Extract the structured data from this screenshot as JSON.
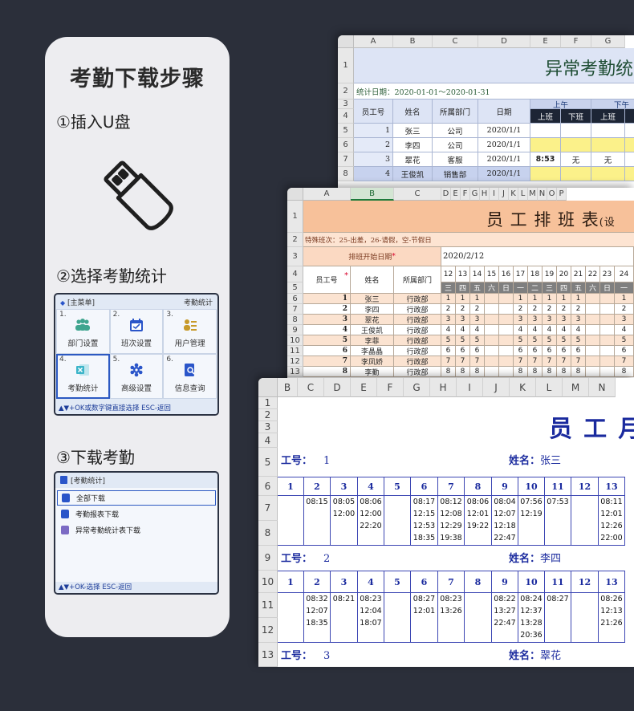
{
  "card": {
    "title": "考勤下载步骤",
    "step1": "①插入U盘",
    "step2": "②选择考勤统计",
    "step3": "③下载考勤"
  },
  "device1": {
    "header_left": "[主菜单]",
    "header_right": "考勤统计",
    "cells": [
      {
        "num": "1.",
        "label": "部门设置",
        "icon": "users-icon",
        "color": "#3fa58f"
      },
      {
        "num": "2.",
        "label": "班次设置",
        "icon": "calendar-icon",
        "color": "#2a55c9"
      },
      {
        "num": "3.",
        "label": "用户管理",
        "icon": "user-list-icon",
        "color": "#c79a2a"
      },
      {
        "num": "4.",
        "label": "考勤统计",
        "icon": "excel-icon",
        "color": "#3bb4c9"
      },
      {
        "num": "5.",
        "label": "高级设置",
        "icon": "gear-icon",
        "color": "#2a55c9"
      },
      {
        "num": "6.",
        "label": "信息查询",
        "icon": "search-doc-icon",
        "color": "#2a55c9"
      }
    ],
    "footer": "▲▼+OK或数字键直接选择 ESC-返回"
  },
  "device2": {
    "header": "[考勤统计]",
    "items": [
      {
        "label": "全部下载",
        "color": "#2a55c9"
      },
      {
        "label": "考勤报表下载",
        "color": "#2a55c9"
      },
      {
        "label": "异常考勤统计表下载",
        "color": "#7c6bc4"
      }
    ],
    "footer": "▲▼+OK-选择 ESC-返回"
  },
  "sheet1": {
    "cols": [
      "A",
      "B",
      "C",
      "D",
      "E",
      "F",
      "G"
    ],
    "rows": [
      "1",
      "2",
      "3",
      "4",
      "5",
      "6",
      "7",
      "8"
    ],
    "title": "异常考勤统",
    "stat_date": "统计日期：2020-01-01～2020-01-31",
    "headers": {
      "id": "员工号",
      "name": "姓名",
      "dept": "所属部门",
      "date": "日期",
      "am": "上午",
      "pm": "下午",
      "in": "上班",
      "out": "下班",
      "in2": "上班"
    },
    "data": [
      {
        "id": "1",
        "name": "张三",
        "dept": "公司",
        "date": "2020/1/1",
        "e": "",
        "f": "",
        "g": ""
      },
      {
        "id": "2",
        "name": "李四",
        "dept": "公司",
        "date": "2020/1/1",
        "e": "",
        "f": "",
        "g": ""
      },
      {
        "id": "3",
        "name": "翠花",
        "dept": "客服",
        "date": "2020/1/1",
        "e": "8:53",
        "f": "无",
        "g": "无"
      },
      {
        "id": "4",
        "name": "王俊凯",
        "dept": "销售部",
        "date": "2020/1/1",
        "e": "",
        "f": "",
        "g": ""
      }
    ]
  },
  "sheet2": {
    "cols": [
      "A",
      "B",
      "C",
      "D",
      "E",
      "F",
      "G",
      "H",
      "I",
      "J",
      "K",
      "L",
      "M",
      "N",
      "O",
      "P"
    ],
    "rows": [
      "1",
      "2",
      "3",
      "4",
      "5",
      "6",
      "7",
      "8",
      "9",
      "10",
      "11",
      "12",
      "13"
    ],
    "title": "员 工 排 班 表",
    "title_suffix": "(设",
    "note": "特殊班次：25-出差，26-请假，空-节假日",
    "start_label": "排班开始日期",
    "start_star": "*",
    "start_value": "2020/2/12",
    "hdr_id": "员工号",
    "hdr_name": "姓名",
    "hdr_dept": "所属部门",
    "days": [
      "12",
      "13",
      "14",
      "15",
      "16",
      "17",
      "18",
      "19",
      "20",
      "21",
      "22",
      "23",
      "24"
    ],
    "weekdays": [
      "三",
      "四",
      "五",
      "六",
      "日",
      "一",
      "二",
      "三",
      "四",
      "五",
      "六",
      "日",
      "一"
    ],
    "data": [
      {
        "id": "1",
        "name": "张三",
        "dept": "行政部",
        "v": [
          "1",
          "1",
          "1",
          "",
          "",
          "1",
          "1",
          "1",
          "1",
          "1",
          "",
          "",
          "1"
        ]
      },
      {
        "id": "2",
        "name": "李四",
        "dept": "行政部",
        "v": [
          "2",
          "2",
          "2",
          "",
          "",
          "2",
          "2",
          "2",
          "2",
          "2",
          "",
          "",
          "2"
        ]
      },
      {
        "id": "3",
        "name": "翠花",
        "dept": "行政部",
        "v": [
          "3",
          "3",
          "3",
          "",
          "",
          "3",
          "3",
          "3",
          "3",
          "3",
          "",
          "",
          "3"
        ]
      },
      {
        "id": "4",
        "name": "王俊凯",
        "dept": "行政部",
        "v": [
          "4",
          "4",
          "4",
          "",
          "",
          "4",
          "4",
          "4",
          "4",
          "4",
          "",
          "",
          "4"
        ]
      },
      {
        "id": "5",
        "name": "李菲",
        "dept": "行政部",
        "v": [
          "5",
          "5",
          "5",
          "",
          "",
          "5",
          "5",
          "5",
          "5",
          "5",
          "",
          "",
          "5"
        ]
      },
      {
        "id": "6",
        "name": "李晶晶",
        "dept": "行政部",
        "v": [
          "6",
          "6",
          "6",
          "",
          "",
          "6",
          "6",
          "6",
          "6",
          "6",
          "",
          "",
          "6"
        ]
      },
      {
        "id": "7",
        "name": "李凤娇",
        "dept": "行政部",
        "v": [
          "7",
          "7",
          "7",
          "",
          "",
          "7",
          "7",
          "7",
          "7",
          "7",
          "",
          "",
          "7"
        ]
      },
      {
        "id": "8",
        "name": "李勤",
        "dept": "行政部",
        "v": [
          "8",
          "8",
          "8",
          "",
          "",
          "8",
          "8",
          "8",
          "8",
          "8",
          "",
          "",
          "8"
        ]
      }
    ]
  },
  "sheet3": {
    "cols": [
      "B",
      "C",
      "D",
      "E",
      "F",
      "G",
      "H",
      "I",
      "J",
      "K",
      "L",
      "M",
      "N"
    ],
    "rows": [
      "1",
      "2",
      "3",
      "4",
      "5",
      "6",
      "7",
      "8",
      "9",
      "10",
      "11",
      "12",
      "13"
    ],
    "title": "员 工 月",
    "id_label": "工号：",
    "name_label": "姓名：",
    "days": [
      "1",
      "2",
      "3",
      "4",
      "5",
      "6",
      "7",
      "8",
      "9",
      "10",
      "11",
      "12",
      "13"
    ],
    "employees": [
      {
        "id": "1",
        "name": "张三",
        "cells": [
          [],
          [
            "08:15"
          ],
          [
            "08:05",
            "12:00"
          ],
          [
            "08:06",
            "12:00",
            "22:20"
          ],
          [],
          [
            "08:17",
            "12:15",
            "12:53",
            "18:35"
          ],
          [
            "08:12",
            "12:08",
            "12:29",
            "19:38"
          ],
          [
            "08:06",
            "12:01",
            "19:22"
          ],
          [
            "08:04",
            "12:07",
            "12:18",
            "22:47"
          ],
          [
            "07:56",
            "12:19"
          ],
          [
            "07:53"
          ],
          [],
          [
            "08:11",
            "12:01",
            "12:26",
            "22:00"
          ]
        ]
      },
      {
        "id": "2",
        "name": "李四",
        "cells": [
          [],
          [
            "08:32",
            "12:07",
            "18:35"
          ],
          [
            "08:21"
          ],
          [
            "08:23",
            "12:04",
            "18:07"
          ],
          [],
          [
            "08:27",
            "12:01"
          ],
          [
            "08:23",
            "13:26"
          ],
          [],
          [
            "08:22",
            "13:27",
            "22:47"
          ],
          [
            "08:24",
            "12:37",
            "13:28",
            "20:36"
          ],
          [
            "08:27"
          ],
          [],
          [
            "08:26",
            "12:13",
            "21:26"
          ]
        ]
      },
      {
        "id": "3",
        "name": "翠花"
      }
    ]
  }
}
